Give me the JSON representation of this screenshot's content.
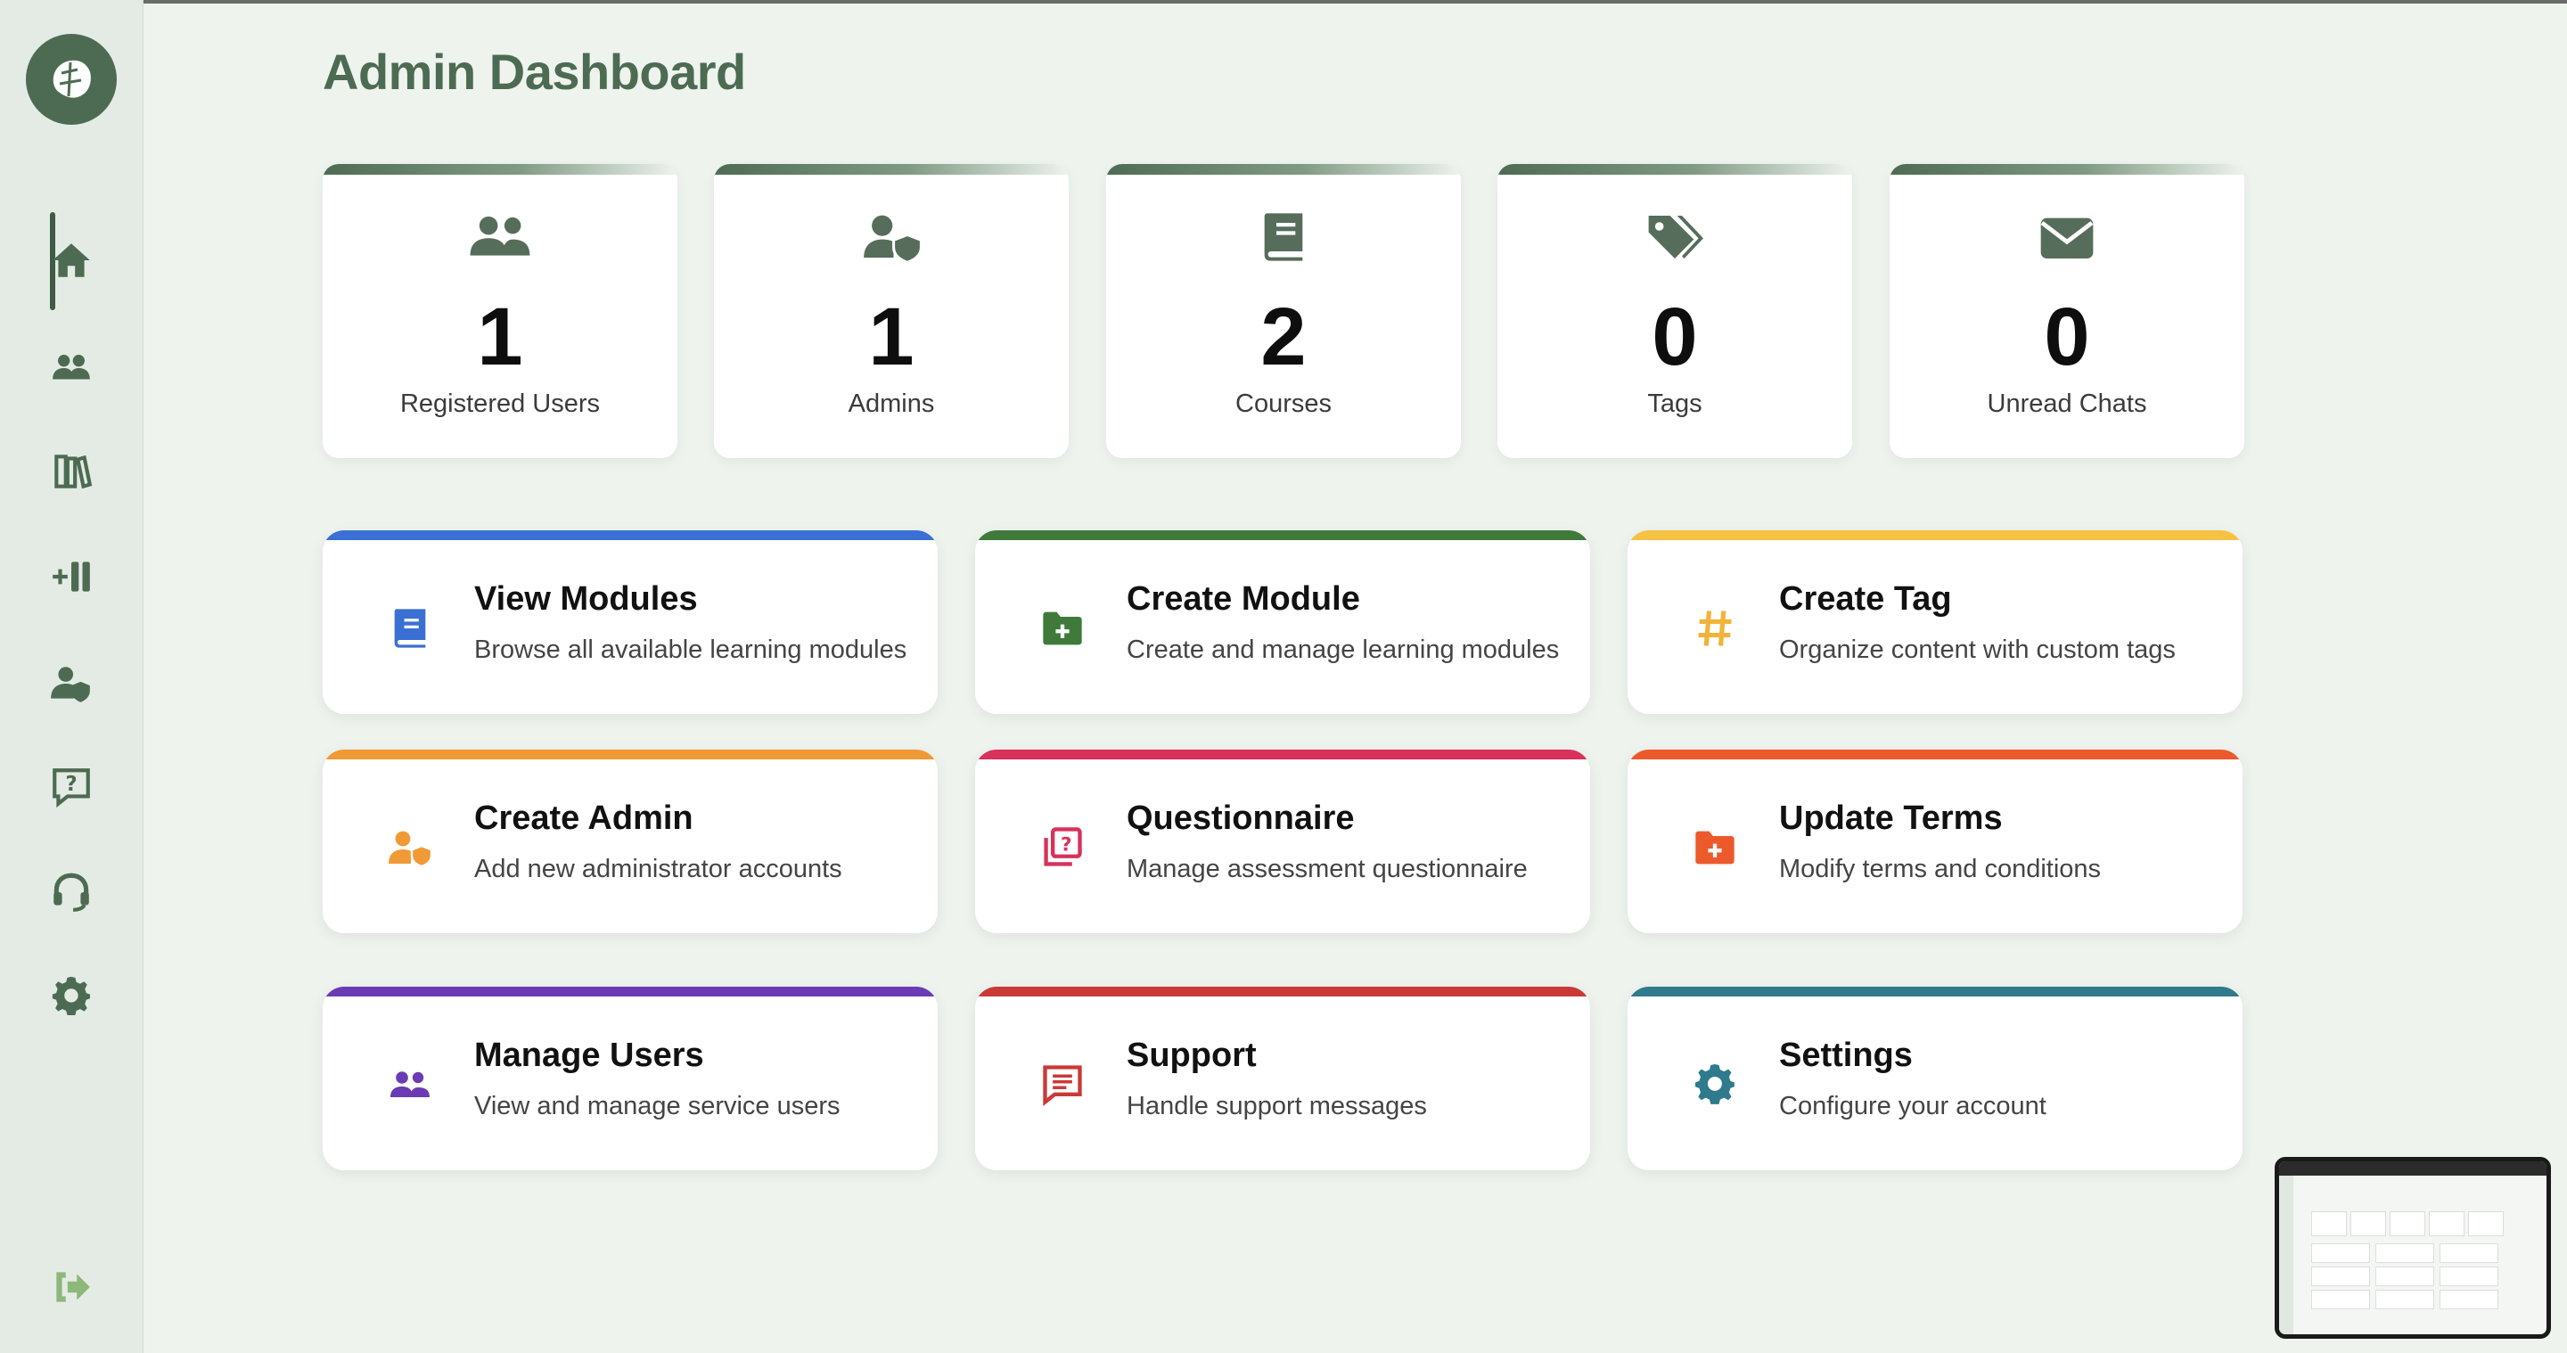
{
  "page_title": "Admin Dashboard",
  "sidebar": {
    "items": [
      {
        "icon": "home-icon"
      },
      {
        "icon": "users-icon"
      },
      {
        "icon": "books-icon"
      },
      {
        "icon": "add-module-icon"
      },
      {
        "icon": "user-shield-icon"
      },
      {
        "icon": "question-icon"
      },
      {
        "icon": "headset-icon"
      },
      {
        "icon": "gear-icon"
      }
    ],
    "logout_icon": "logout-icon"
  },
  "stats": [
    {
      "value": "1",
      "label": "Registered Users",
      "icon": "users-icon"
    },
    {
      "value": "1",
      "label": "Admins",
      "icon": "user-shield-icon"
    },
    {
      "value": "2",
      "label": "Courses",
      "icon": "book-icon"
    },
    {
      "value": "0",
      "label": "Tags",
      "icon": "tags-icon"
    },
    {
      "value": "0",
      "label": "Unread Chats",
      "icon": "envelope-icon"
    }
  ],
  "cards": [
    {
      "title": "View Modules",
      "desc": "Browse all available learning modules",
      "color": "#3a6fd4",
      "icon": "book-icon"
    },
    {
      "title": "Create Module",
      "desc": "Create and manage learning modules",
      "color": "#3f7a3b",
      "icon": "folder-plus-icon"
    },
    {
      "title": "Create Tag",
      "desc": "Organize content with custom tags",
      "color": "#f6c244",
      "icon": "hashtag-icon"
    },
    {
      "title": "Create Admin",
      "desc": "Add new administrator accounts",
      "color": "#f09a36",
      "icon": "user-shield-icon"
    },
    {
      "title": "Questionnaire",
      "desc": "Manage assessment questionnaire",
      "color": "#d8315b",
      "icon": "question-icon"
    },
    {
      "title": "Update Terms",
      "desc": "Modify terms and conditions",
      "color": "#ec5a2c",
      "icon": "folder-plus-icon"
    },
    {
      "title": "Manage Users",
      "desc": "View and manage service users",
      "color": "#6a3bb5",
      "icon": "users-icon"
    },
    {
      "title": "Support",
      "desc": "Handle support messages",
      "color": "#c93a36",
      "icon": "message-icon"
    },
    {
      "title": "Settings",
      "desc": "Configure your account",
      "color": "#2f7a8c",
      "icon": "gear-icon"
    }
  ]
}
